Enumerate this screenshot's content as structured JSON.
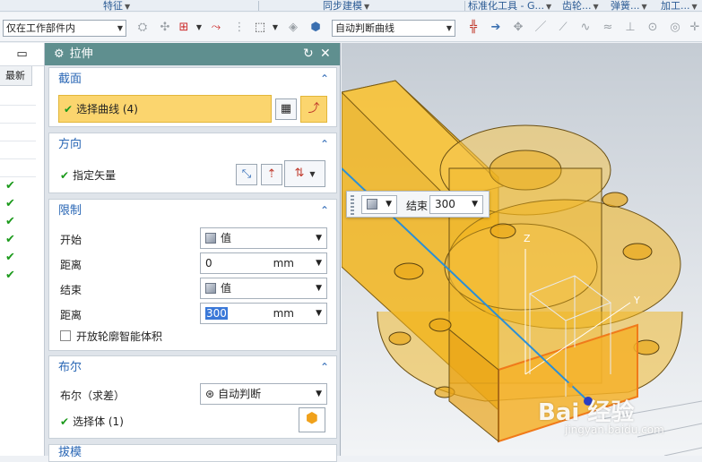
{
  "ribbon": {
    "groups": [
      "特征",
      "同步建模",
      "标准化工具 - G...",
      "齿轮...",
      "弹簧...",
      "加工..."
    ]
  },
  "toolbar": {
    "filter_combo": "仅在工作部件内",
    "curve_rule_combo": "自动判断曲线"
  },
  "resource_bar": {
    "column_header": "最新",
    "check_count": 6
  },
  "dialog": {
    "title": "拉伸",
    "section_profile": {
      "header": "截面",
      "select_curve": "选择曲线 (4)"
    },
    "section_direction": {
      "header": "方向",
      "specify_vector": "指定矢量"
    },
    "section_limits": {
      "header": "限制",
      "start_label": "开始",
      "start_value": "值",
      "distance1_label": "距离",
      "distance1_value": "0",
      "distance1_unit": "mm",
      "end_label": "结束",
      "end_value": "值",
      "distance2_label": "距离",
      "distance2_value": "300",
      "distance2_unit": "mm",
      "open_profile_label": "开放轮廓智能体积"
    },
    "section_boolean": {
      "header": "布尔",
      "boolean_label": "布尔（求差）",
      "boolean_value": "自动判断",
      "select_body": "选择体 (1)"
    },
    "section_draft": {
      "header": "拔模"
    }
  },
  "floater": {
    "label": "结束",
    "value": "300"
  },
  "viewport": {
    "axis_z": "Z",
    "axis_y": "Y"
  },
  "watermark": {
    "main": "Bai 经验",
    "sub": "jingyan.baidu.com"
  },
  "colors": {
    "dialog_title": "#5f8f8f",
    "section_header": "#2a67b5",
    "selection_highlight": "#fbd56e",
    "part_fill": "#f2b51d",
    "part_edge": "#7a5a10",
    "check_green": "#1c9a1c"
  }
}
